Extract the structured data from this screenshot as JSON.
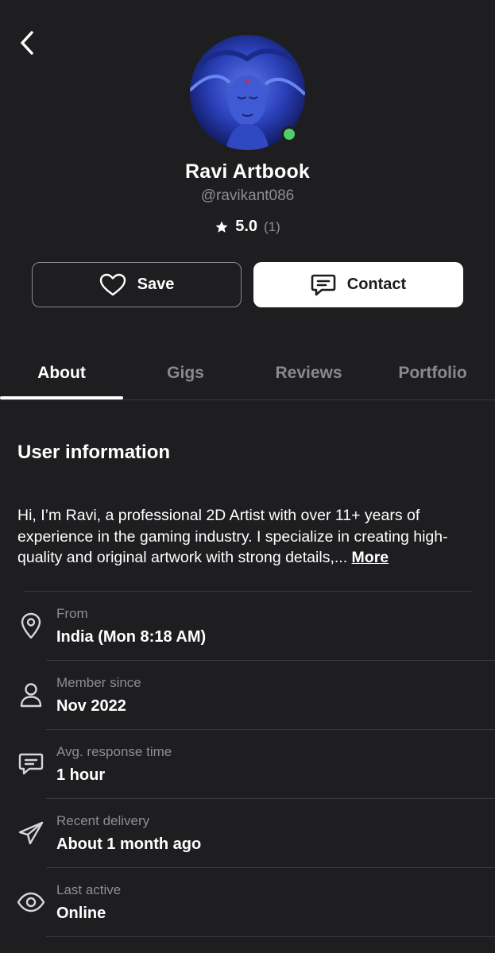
{
  "header": {
    "back_icon": "chevron-left-icon"
  },
  "profile": {
    "display_name": "Ravi Artbook",
    "username": "@ravikant086",
    "rating": "5.0",
    "rating_count": "(1)",
    "online_color": "#4fce6a"
  },
  "actions": {
    "save_label": "Save",
    "contact_label": "Contact"
  },
  "tabs": [
    {
      "label": "About",
      "active": true
    },
    {
      "label": "Gigs",
      "active": false
    },
    {
      "label": "Reviews",
      "active": false
    },
    {
      "label": "Portfolio",
      "active": false
    }
  ],
  "about": {
    "section_title": "User information",
    "bio": "Hi, I’m Ravi, a professional 2D Artist with over 11+ years of experience in the gaming industry. I specialize in creating high-quality and original artwork with strong details,...",
    "more_label": "More",
    "info": [
      {
        "icon": "location-pin-icon",
        "label": "From",
        "value": "India (Mon 8:18 AM)"
      },
      {
        "icon": "user-icon",
        "label": "Member since",
        "value": "Nov 2022"
      },
      {
        "icon": "chat-icon",
        "label": "Avg. response time",
        "value": "1 hour"
      },
      {
        "icon": "send-icon",
        "label": "Recent delivery",
        "value": "About 1 month ago"
      },
      {
        "icon": "eye-icon",
        "label": "Last active",
        "value": "Online"
      }
    ]
  }
}
